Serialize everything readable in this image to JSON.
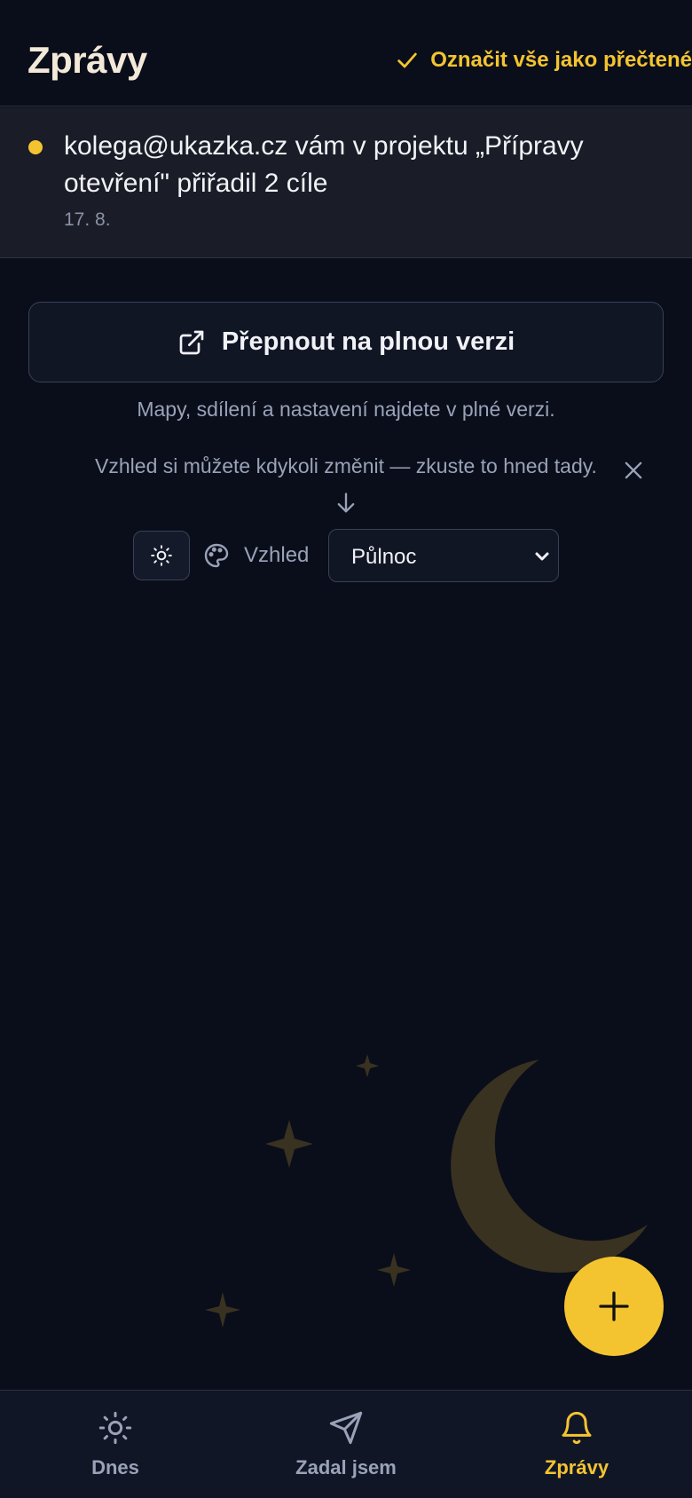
{
  "header": {
    "title": "Zprávy",
    "mark_all_label": "Označit vše jako přečtené"
  },
  "notifications": [
    {
      "text": "kolega@ukazka.cz vám v projektu „Přípravy otevření\" přiřadil 2 cíle",
      "date": "17. 8.",
      "unread": true
    }
  ],
  "switch": {
    "button_label": "Přepnout na plnou verzi",
    "hint": "Mapy, sdílení a nastavení najdete v plné verzi."
  },
  "appearance": {
    "hint": "Vzhled si můžete kdykoli změnit — zkuste to hned tady.",
    "label": "Vzhled",
    "selected": "Půlnoc"
  },
  "bottom_nav": {
    "items": [
      {
        "label": "Dnes",
        "icon": "sun-icon"
      },
      {
        "label": "Zadal jsem",
        "icon": "send-icon"
      },
      {
        "label": "Zprávy",
        "icon": "bell-icon",
        "active": true
      }
    ]
  },
  "colors": {
    "background": "#0a0e1a",
    "accent": "#f4c430",
    "surface": "#1a1d27"
  }
}
